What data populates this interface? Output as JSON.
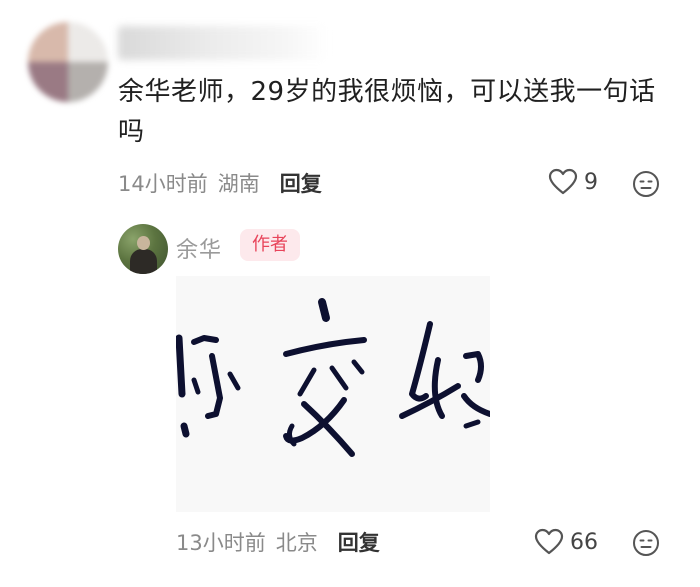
{
  "comment": {
    "text": "余华老师，29岁的我很烦恼，可以送我一句话吗",
    "time": "14小时前",
    "location": "湖南",
    "reply_label": "回复",
    "like_count": "9",
    "like_icon": "heart-outline-icon",
    "emoji_icon": "neutral-face-icon"
  },
  "reply": {
    "author": "余华",
    "badge": "作者",
    "image_text": "你交好",
    "time": "13小时前",
    "location": "北京",
    "reply_label": "回复",
    "like_count": "66",
    "like_icon": "heart-outline-icon",
    "emoji_icon": "neutral-face-icon"
  },
  "colors": {
    "badge_text": "#e8445a",
    "badge_bg": "#fde9ec",
    "meta_text": "#8a8a8a",
    "ink": "#0d1030"
  }
}
